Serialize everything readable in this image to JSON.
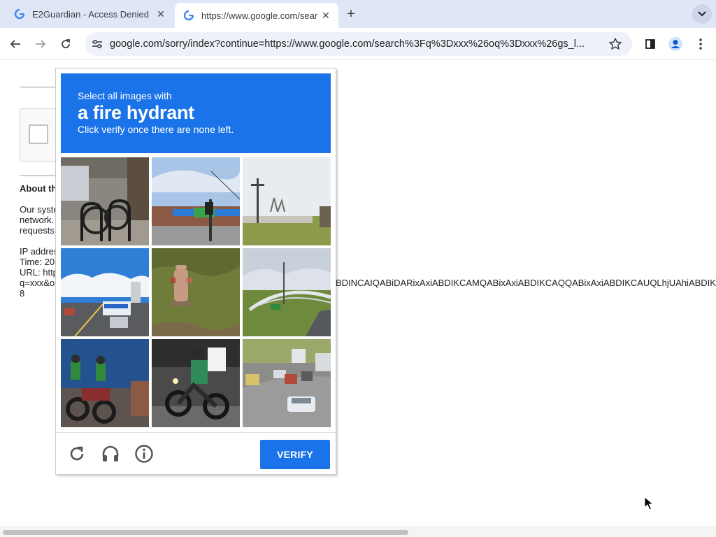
{
  "tabs": [
    {
      "title": "E2Guardian - Access Denied",
      "active": false
    },
    {
      "title": "https://www.google.com/sear",
      "active": true
    }
  ],
  "toolbar": {
    "url": "google.com/sorry/index?continue=https://www.google.com/search%3Fq%3Dxxx%26oq%3Dxxx%26gs_l..."
  },
  "page": {
    "about_heading": "About th",
    "para1": [
      "Our syste",
      "network.",
      "requests"
    ],
    "para2": [
      "IP addres",
      "Time: 20",
      "URL: http",
      "q=xxx&o",
      "8"
    ],
    "url_tail": "BDINCAIQABiDARixAxiABDIKCAMQABixAxiABDIKCAQQABixAxiABDIKCAUQLhjUAhiABDIKC"
  },
  "challenge": {
    "line1": "Select all images with",
    "object": "a fire hydrant",
    "line3": "Click verify once there are none left.",
    "verify_label": "VERIFY",
    "tiles": [
      {
        "scene": "bike-rack"
      },
      {
        "scene": "storefront-traffic-light"
      },
      {
        "scene": "utility-pole-field"
      },
      {
        "scene": "road-with-bus"
      },
      {
        "scene": "fire-hydrant-grass"
      },
      {
        "scene": "bridge-highway"
      },
      {
        "scene": "motorcycles-blue-wall"
      },
      {
        "scene": "motorcycle-rider"
      },
      {
        "scene": "traffic-street"
      }
    ]
  },
  "colors": {
    "accent": "#1a73e8",
    "tabstrip": "#dfe6f6",
    "omnibox": "#eef1f8"
  }
}
